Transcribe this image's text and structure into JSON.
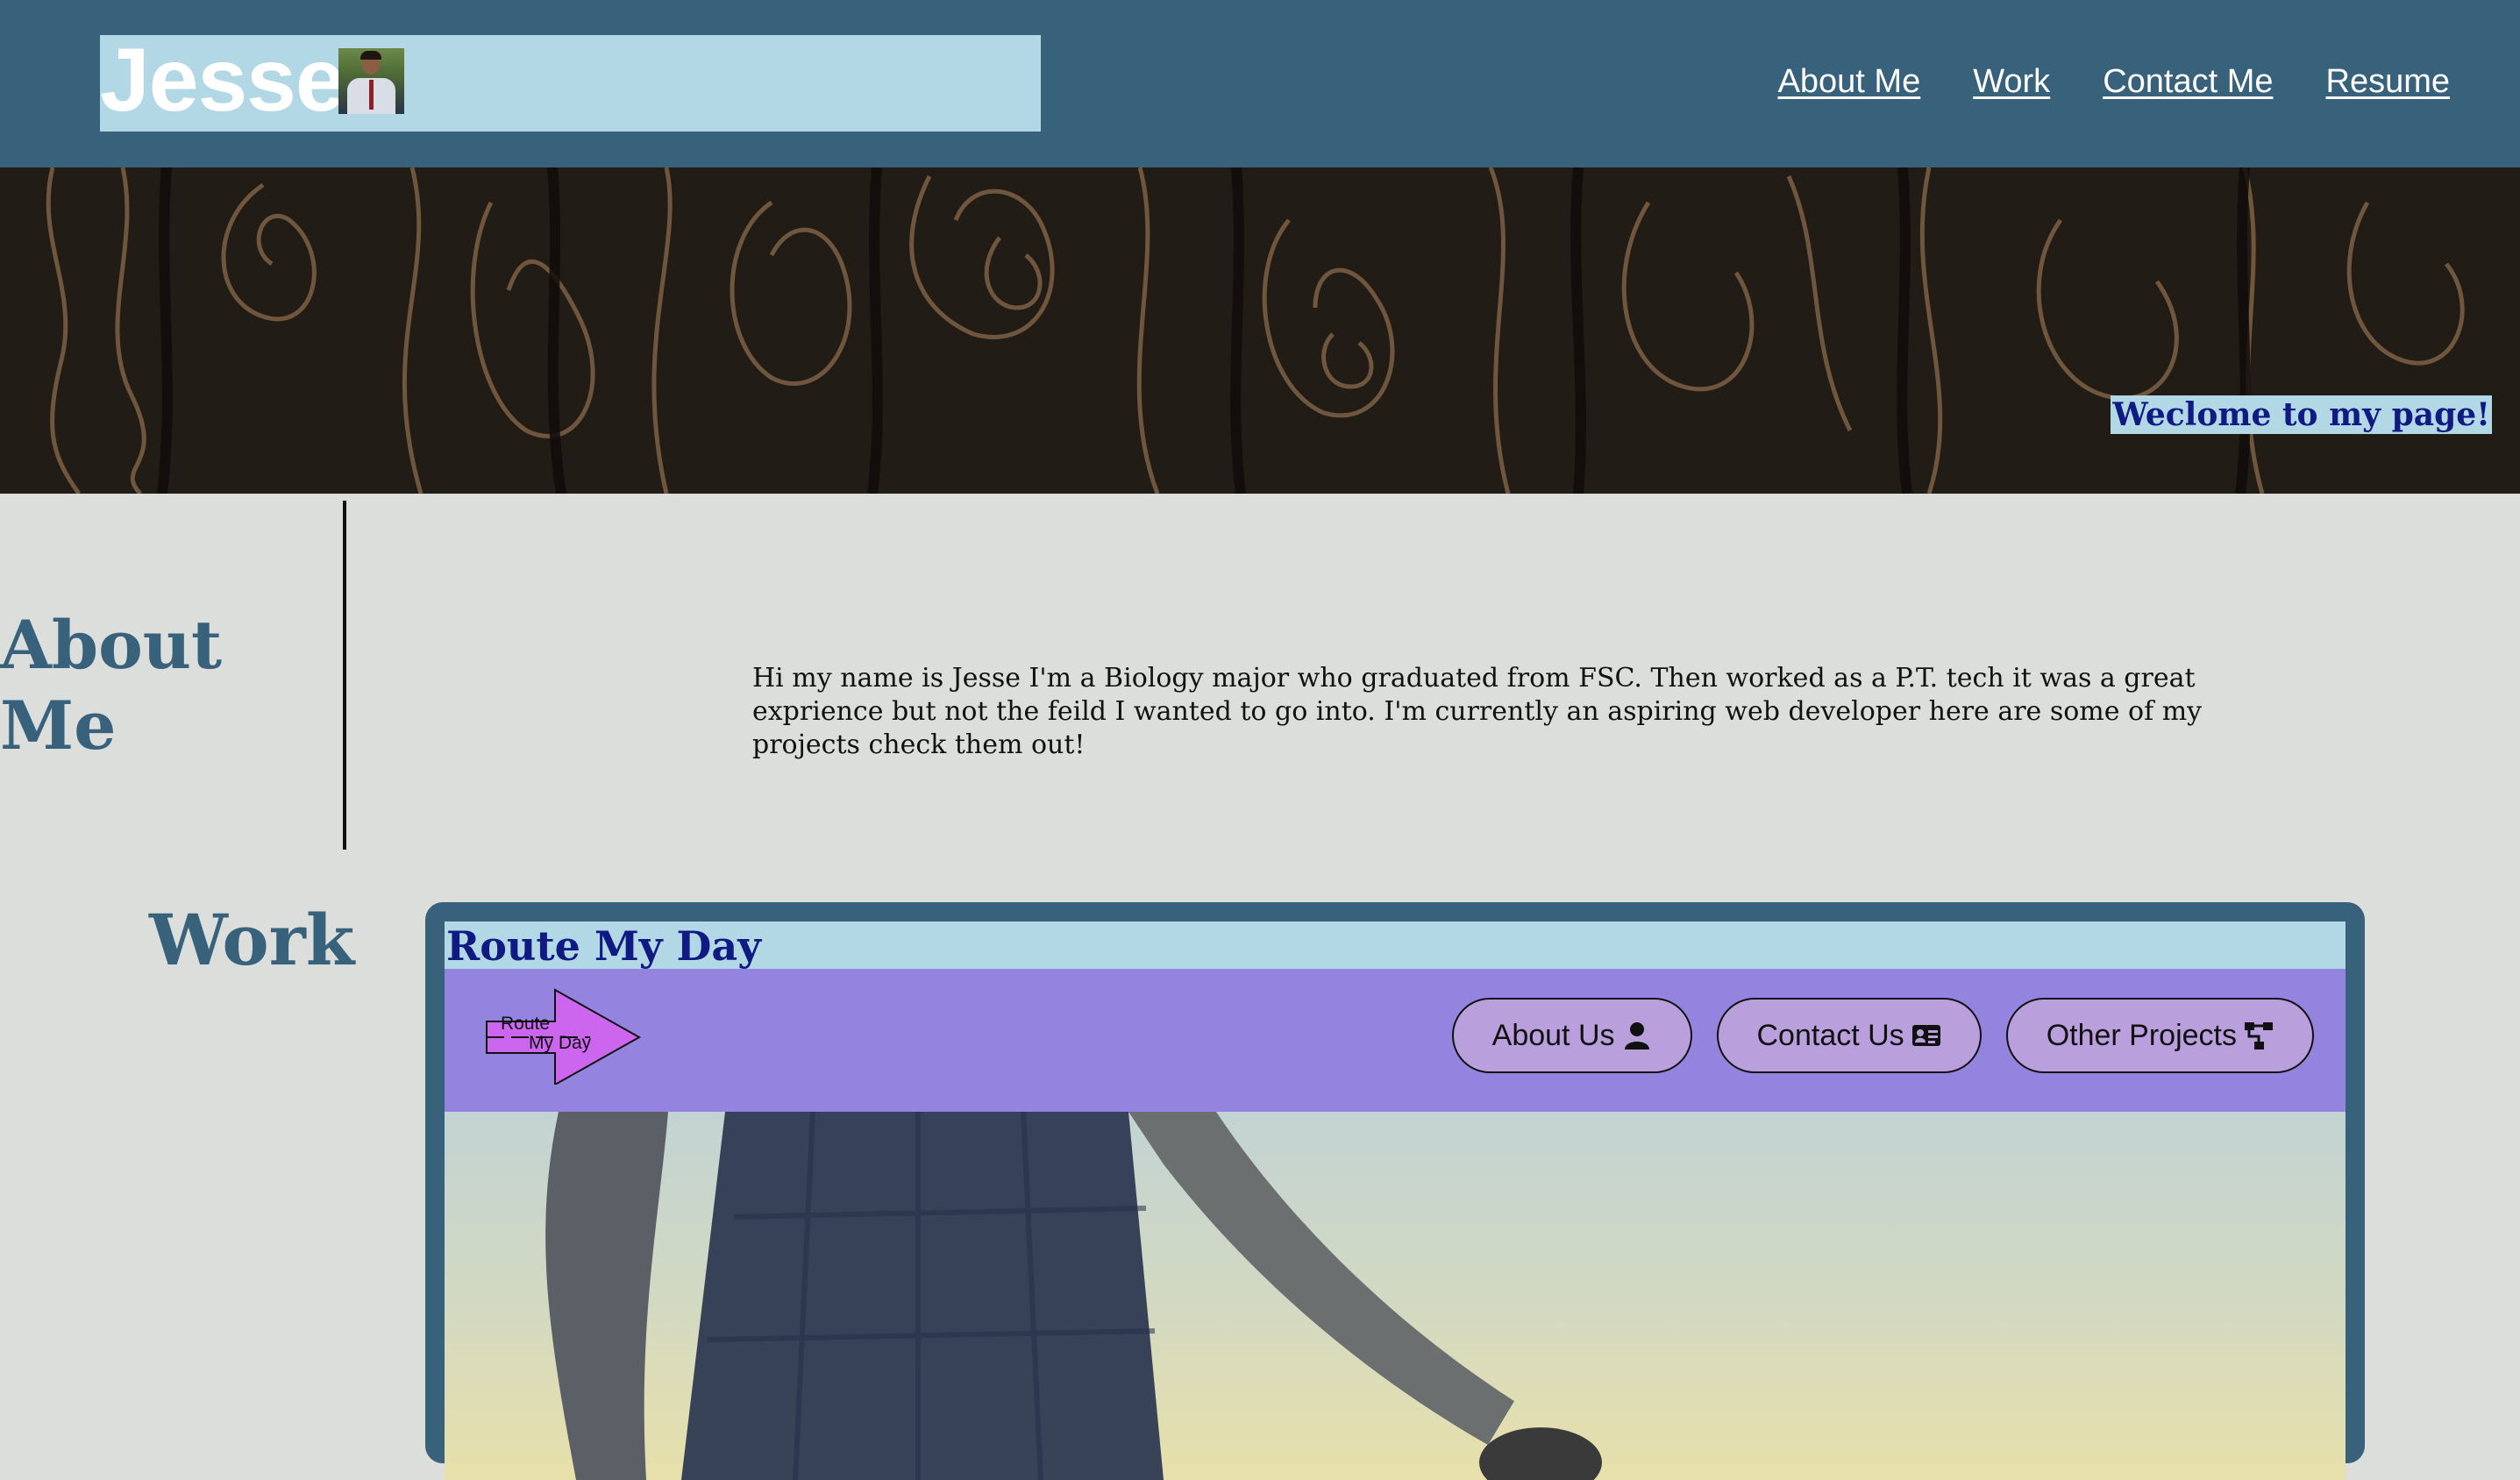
{
  "header": {
    "brand_name": "Jesse",
    "nav": [
      "About Me",
      "Work",
      "Contact Me",
      "Resume"
    ]
  },
  "hero": {
    "welcome_text": "Weclome to my page!"
  },
  "about": {
    "title": "About Me",
    "text": "Hi my name is Jesse I'm a Biology major who graduated from FSC. Then worked as a P.T. tech it was a great exprience but not the feild I wanted to go into. I'm currently an aspiring web developer here are some of my projects check them out!"
  },
  "work": {
    "title": "Work",
    "project": {
      "title": "Route My Day",
      "logo_line1": "Route",
      "logo_line2": "My Day",
      "nav": [
        {
          "label": "About Us",
          "icon": "user-icon"
        },
        {
          "label": "Contact Us",
          "icon": "id-card-icon"
        },
        {
          "label": "Other Projects",
          "icon": "sitemap-icon"
        }
      ]
    }
  },
  "colors": {
    "header_bg": "#38617c",
    "brand_bg": "#b3d8e5",
    "page_bg": "#dcdedb",
    "heading": "#38617c",
    "project_nav_bg": "#9484e0",
    "pill_bg": "#b9a0dc",
    "logo_arrow": "#cc66ee",
    "welcome_text": "#0f1a82"
  }
}
